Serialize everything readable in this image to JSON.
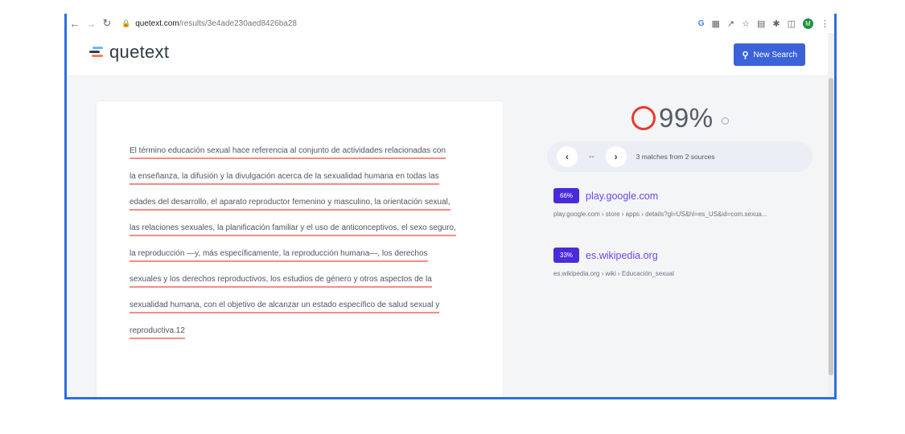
{
  "browser": {
    "url_domain": "quetext.com",
    "url_path": "/results/3e4ade230aed8426ba28",
    "profile_initial": "M"
  },
  "header": {
    "logo_text": "quetext",
    "new_search_label": "New Search"
  },
  "document": {
    "lines": [
      "El término educación sexual hace referencia al conjunto de actividades relacionadas con",
      "la enseñanza, la difusión y la divulgación acerca de la sexualidad humana en todas las",
      "edades del desarrollo, el aparato reproductor femenino y masculino, la orientación sexual,",
      "las relaciones sexuales, la planificación familiar y el uso de anticonceptivos, el sexo seguro,",
      "la reproducción —y, más específicamente, la reproducción humana—, los derechos",
      "sexuales y los derechos reproductivos, los estudios de género y otros aspectos de la",
      "sexualidad humana, con el objetivo de alcanzar un estado específico de salud sexual y",
      "reproductiva.12"
    ]
  },
  "results": {
    "score": "99%",
    "pagination": "--",
    "matches_text": "3 matches from 2 sources",
    "sources": [
      {
        "percent": "66%",
        "title": "play.google.com",
        "url": "play.google.com › store › apps › details?gl=US&hl=es_US&id=com.sexua..."
      },
      {
        "percent": "33%",
        "title": "es.wikipedia.org",
        "url": "es.wikipedia.org › wiki › Educación_sexual"
      }
    ]
  },
  "colors": {
    "accent": "#3b62d9",
    "score_ring": "#e8392e",
    "badge": "#4a2bd9",
    "source_link": "#6a47e8",
    "highlight_underline": "#f48c86",
    "frame_border": "#2b6fe0"
  }
}
